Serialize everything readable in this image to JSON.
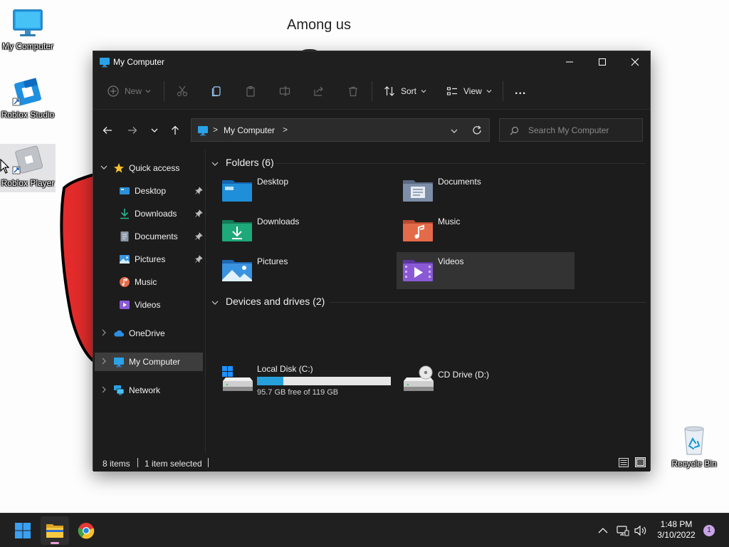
{
  "desktop": {
    "wallpaper_text": "Among us",
    "icons": [
      {
        "label": "My Computer",
        "icon": "monitor-icon"
      },
      {
        "label": "Roblox Studio",
        "icon": "roblox-studio-icon"
      },
      {
        "label": "Roblox Player",
        "icon": "roblox-player-icon"
      },
      {
        "label": "Recycle Bin",
        "icon": "recycle-bin-icon"
      }
    ]
  },
  "window": {
    "title": "My Computer",
    "toolbar": {
      "new_label": "New",
      "sort_label": "Sort",
      "view_label": "View",
      "more_label": "..."
    },
    "address": {
      "crumb": "My Computer",
      "separator": ">"
    },
    "search": {
      "placeholder": "Search My Computer"
    },
    "sidebar": {
      "quick_access": "Quick access",
      "quick_items": [
        {
          "label": "Desktop",
          "pinned": true
        },
        {
          "label": "Downloads",
          "pinned": true
        },
        {
          "label": "Documents",
          "pinned": true
        },
        {
          "label": "Pictures",
          "pinned": true
        },
        {
          "label": "Music",
          "pinned": false
        },
        {
          "label": "Videos",
          "pinned": false
        }
      ],
      "onedrive": "OneDrive",
      "my_computer": "My Computer",
      "network": "Network"
    },
    "content": {
      "folders_header": "Folders (6)",
      "folders": [
        {
          "name": "Desktop",
          "icon": "desktop-folder-icon",
          "color": "#1e8fd8"
        },
        {
          "name": "Documents",
          "icon": "documents-folder-icon",
          "color": "#7d8ea8"
        },
        {
          "name": "Downloads",
          "icon": "downloads-folder-icon",
          "color": "#1fa87a"
        },
        {
          "name": "Music",
          "icon": "music-folder-icon",
          "color": "#e46b4a"
        },
        {
          "name": "Pictures",
          "icon": "pictures-folder-icon",
          "color": "#3a93e0"
        },
        {
          "name": "Videos",
          "icon": "videos-folder-icon",
          "color": "#8a5ad6"
        }
      ],
      "drives_header": "Devices and drives (2)",
      "drives": [
        {
          "name": "Local Disk (C:)",
          "free_text": "95.7 GB free of 119 GB",
          "used_fraction": 0.196
        },
        {
          "name": "CD Drive (D:)"
        }
      ]
    },
    "status": {
      "items": "8 items",
      "selected": "1 item selected"
    }
  },
  "taskbar": {
    "time": "1:48 PM",
    "date": "3/10/2022",
    "notification_count": "1"
  },
  "colors": {
    "accent": "#26a0da",
    "window_bg": "#1c1c1c",
    "taskbar_bg": "#202020"
  }
}
